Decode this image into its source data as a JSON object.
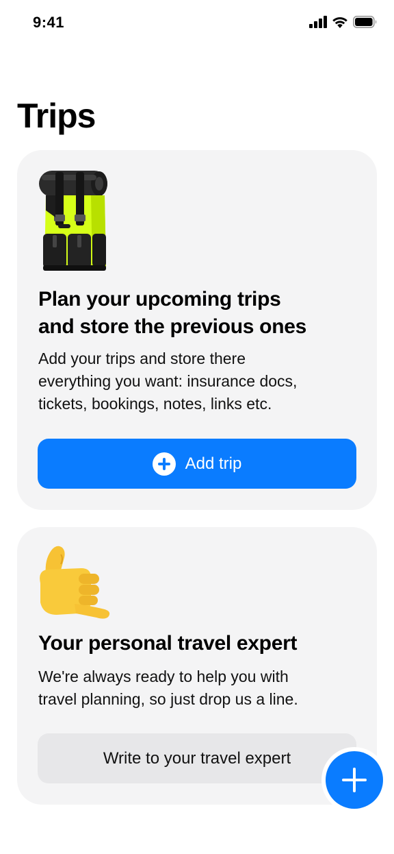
{
  "status_bar": {
    "time": "9:41",
    "icons": [
      "cellular-signal-icon",
      "wifi-icon",
      "battery-icon"
    ]
  },
  "page": {
    "title": "Trips"
  },
  "trip_card": {
    "illustration": "backpack-icon",
    "heading_line1": "Plan your upcoming trips",
    "heading_line2": "and store the previous ones",
    "text_line1": "Add your trips and store there",
    "text_line2": "everything you want: insurance docs,",
    "text_line3": "tickets, bookings, notes, links etc.",
    "button_label": "Add trip",
    "button_icon": "plus-circle-icon"
  },
  "expert_card": {
    "illustration": "call-me-hand-icon",
    "heading": "Your personal travel expert",
    "text_line1": "We're always ready to help you with",
    "text_line2": "travel planning, so just drop us a line.",
    "button_label": "Write to your travel expert"
  },
  "fab": {
    "icon": "plus-icon"
  },
  "colors": {
    "accent": "#0a7cff",
    "card_background": "#f4f4f5",
    "secondary_button": "#e7e7e9",
    "backpack_neon": "#d6ff19"
  }
}
